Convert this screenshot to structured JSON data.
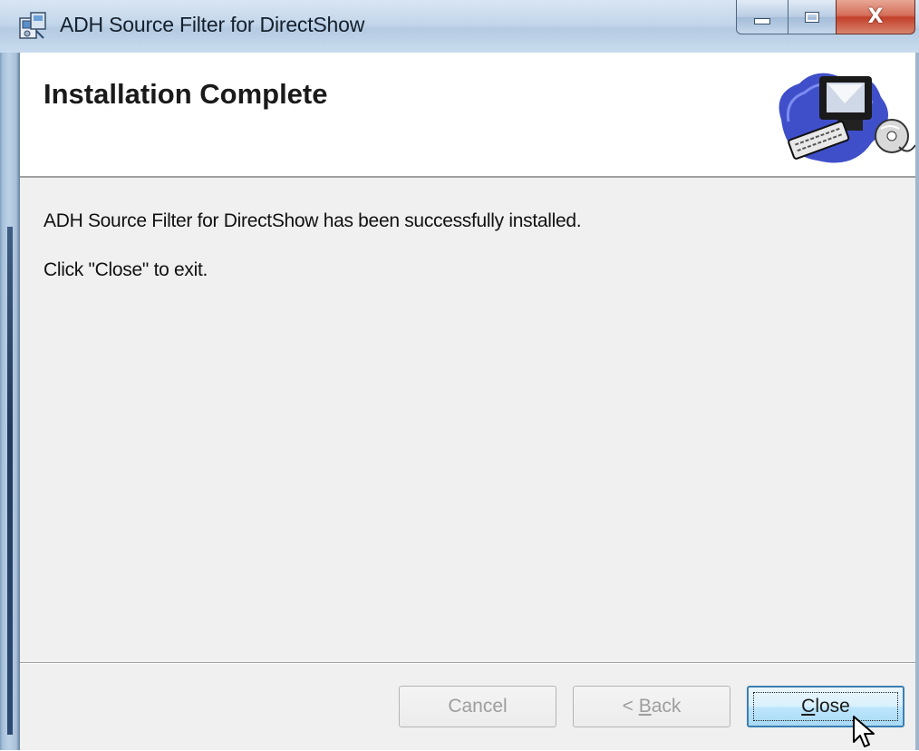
{
  "window": {
    "title": "ADH Source Filter for DirectShow",
    "caption_buttons": {
      "minimize": "minimize-icon",
      "maximize": "maximize-icon",
      "close": "X"
    }
  },
  "banner": {
    "title": "Installation Complete",
    "art_icon": "computer-cd-icon"
  },
  "body": {
    "line1": "ADH Source Filter for DirectShow has been successfully installed.",
    "line2": "Click \"Close\" to exit."
  },
  "buttons": {
    "cancel": {
      "label": "Cancel",
      "enabled": false
    },
    "back": {
      "label_prefix": "< ",
      "label_mnemonic": "B",
      "label_rest": "ack",
      "enabled": false
    },
    "close": {
      "label_mnemonic": "C",
      "label_rest": "lose",
      "enabled": true,
      "focused": true
    }
  },
  "colors": {
    "titlebar": "#c3d6ea",
    "close_caption": "#c3402a",
    "dialog_bg": "#f0f0f0",
    "focused_button_border": "#3c7fb1"
  }
}
